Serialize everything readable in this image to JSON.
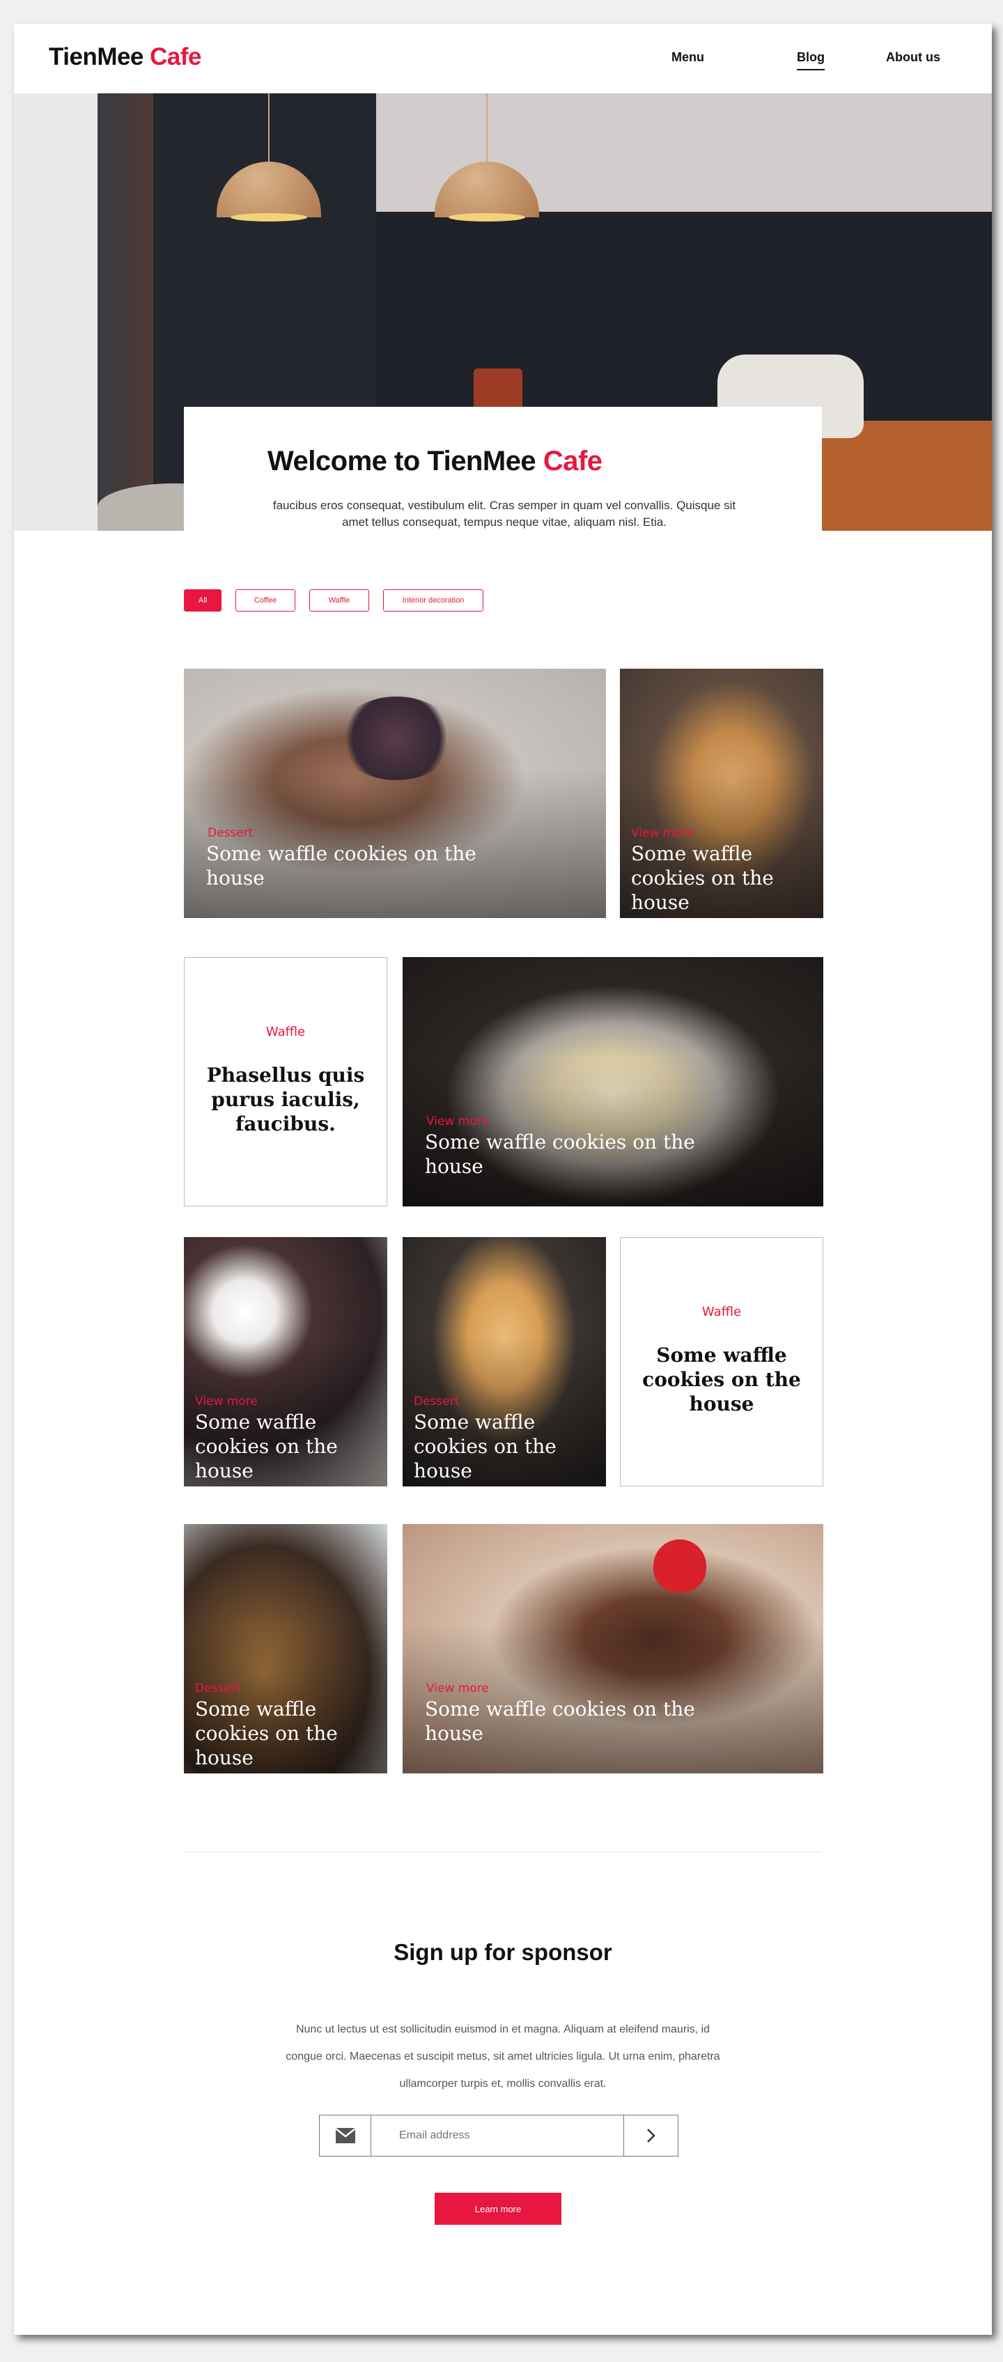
{
  "header": {
    "logo_main": "TienMee",
    "logo_accent": "Cafe",
    "nav": [
      {
        "label": "Menu"
      },
      {
        "label": "Blog"
      },
      {
        "label": "About us"
      }
    ],
    "active_nav": "Blog"
  },
  "hero": {
    "title_main": "Welcome to TienMee",
    "title_accent": "Cafe",
    "text": "faucibus eros consequat, vestibulum elit. Cras semper in quam vel convallis. Quisque sit amet tellus consequat, tempus neque vitae, aliquam nisl. Etia."
  },
  "filters": [
    {
      "label": "All"
    },
    {
      "label": "Coffee"
    },
    {
      "label": "Waffle"
    },
    {
      "label": "Interior decoration"
    }
  ],
  "active_filter": "All",
  "posts": [
    {
      "category": "Dessert",
      "title": "Some waffle cookies on the house",
      "image": "waffle-berries-photo"
    },
    {
      "category": "View more",
      "title": "Some waffle cookies on the house",
      "image": "pancake-stack-photo"
    },
    {
      "category": "Waffle",
      "title": "Phasellus quis purus iaculis, faucibus."
    },
    {
      "category": "View more",
      "title": "Some waffle cookies on the house",
      "image": "cheesecake-photo"
    },
    {
      "category": "View more",
      "title": "Some waffle cookies on the house",
      "image": "cupcakes-photo"
    },
    {
      "category": "Dessert",
      "title": "Some waffle cookies on the house",
      "image": "blueberry-pancake-photo"
    },
    {
      "category": "Waffle",
      "title": "Some waffle cookies on the house"
    },
    {
      "category": "Dessert",
      "title": "Some waffle cookies on the house",
      "image": "candy-apples-photo"
    },
    {
      "category": "View more",
      "title": "Some waffle cookies on the house",
      "image": "chocolate-cake-photo"
    }
  ],
  "sponsor": {
    "title": "Sign up for sponsor",
    "text": "Nunc ut lectus ut est sollicitudin euismod in et magna. Aliquam at eleifend mauris, id congue orci. Maecenas et suscipit metus, sit amet ultricies ligula. Ut urna enim, pharetra ullamcorper turpis et, mollis convallis erat.",
    "email_placeholder": "Email address",
    "button_label": "Learn more"
  },
  "colors": {
    "accent": "#e8173f"
  }
}
